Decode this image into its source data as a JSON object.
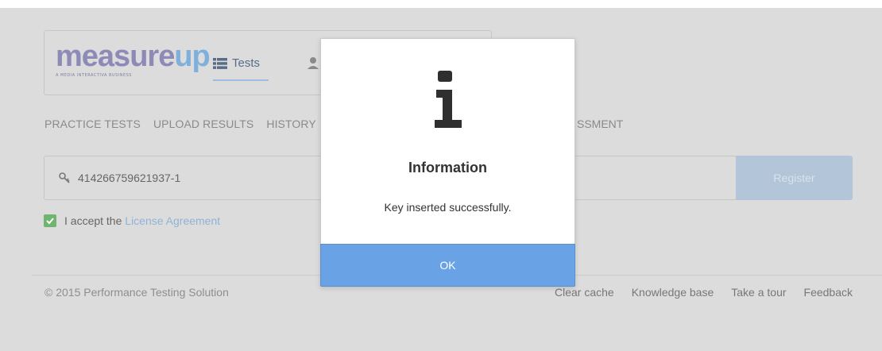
{
  "header": {
    "logo_word_a": "measure",
    "logo_word_b": "up",
    "logo_tagline": "A MEDIA INTERACTIVA BUSINESS",
    "nav_tests_label": "Tests"
  },
  "subnav": {
    "items": [
      "PRACTICE TESTS",
      "UPLOAD RESULTS",
      "HISTORY"
    ],
    "right_fragment": "SSMENT"
  },
  "key_entry": {
    "value": "414266759621937-1",
    "register_label": "Register"
  },
  "license": {
    "checked": true,
    "prefix": "I accept the",
    "link_label": "License Agreement"
  },
  "footer": {
    "copyright": "© 2015 Performance Testing Solution",
    "links": [
      "Clear cache",
      "Knowledge base",
      "Take a tour",
      "Feedback"
    ]
  },
  "modal": {
    "title": "Information",
    "message": "Key inserted successfully.",
    "ok_label": "OK",
    "icon": "info-icon"
  },
  "colors": {
    "background": "#dcdcdc",
    "accent_blue": "#6aa3e5",
    "register_disabled": "#b3c6d9",
    "checkbox_green": "#6fb46f",
    "link_blue": "#8fb4d6"
  }
}
